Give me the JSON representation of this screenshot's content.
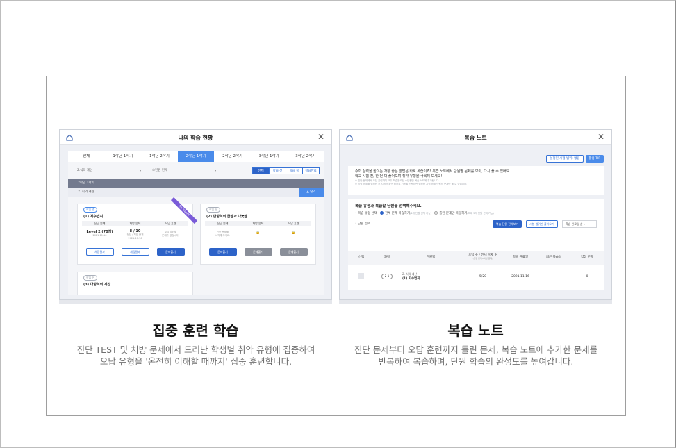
{
  "left_panel": {
    "title": "나의 학습 현황",
    "semester_tabs": [
      "전체",
      "1학년 1학기",
      "1학년 2학기",
      "2학년 1학기",
      "2학년 2학기",
      "3학년 1학기",
      "3학년 2학기"
    ],
    "active_tab": "2학년 1학기",
    "unit_select": "2.식의 계산",
    "subunit_select": "소단원 전체",
    "filter_buttons": [
      "전체",
      "학습 전",
      "학습 중",
      "학습완료"
    ],
    "semester_bar": "2학년 1학기",
    "unit_bar": "2. 식의 계산",
    "fold_button": "▲ 닫기",
    "columns": [
      "진단 문제",
      "처방 문제",
      "오답 훈련"
    ],
    "cards": [
      {
        "status": "학습 중",
        "title": "(1) 지수법칙",
        "ribbon": "최신 학습내역",
        "level": "Level 2 (70점)",
        "level_date": "2021.11.16",
        "score": "8 / 10",
        "score_sub": "정답 / 처방 문제",
        "score_date": "2021.11.16",
        "train_note_1": "오답 훈련할",
        "train_note_2": "문제가 없습니다.",
        "btn_result_1": "채점결과",
        "btn_result_2": "채점결과",
        "btn_solve": "문제풀기"
      },
      {
        "status": "학습 전",
        "title": "(2) 단항식의 곱셈과 나눗셈",
        "diag_note_1": "진단 문제를",
        "diag_note_2": "시작해 주세요.",
        "btn_solve": "문제풀기",
        "lock_1": "🔒",
        "lock_2": "🔒",
        "btn_locked_1": "문제풀기",
        "btn_locked_2": "문제풀기"
      },
      {
        "status": "학습 전",
        "title": "(3) 다항식의 계산"
      }
    ]
  },
  "right_panel": {
    "title": "복습 노트",
    "btn_scope": "설정된 시험 범위: 없음",
    "btn_tip": "활용 TIP",
    "intro_1": "수학 실력을 높이는 가장 좋은 방법은 바로 복습이죠! 복습 노트에서 단원별 문제를 모아, 다시 풀 수 있어요.",
    "intro_2": "학교 시험 전, 한 번 더 풀어보며 취약 유형을 극복해 보세요!",
    "intro_note_1": "※ 진단 문제에서 오답 훈련까지 모두 학습완료된 소단원만 복습 노트에 추가됩니다.",
    "intro_note_2": "※ 시험 범위를 설정한 후 시험 범위만 풀어요 기능을 선택하면 설정한 시험 범위 단원의 문제만 볼 수 있습니다.",
    "review_question": "복습 유형과 복습할 단원을 선택해주세요.",
    "radio_label": "복습 유형 선택",
    "radio_1": "전체 문제 복습하기",
    "radio_1_note": "(1개 단원 선택 가능)",
    "radio_2": "틀린 문제만 복습하기",
    "radio_2_note": "(최대 5개 단원 선택 가능)",
    "unit_choice_label": "단원 선택",
    "btn_view_all": "복습 단원 전체보기",
    "btn_exam_range": "시험 범위만 풀어요기",
    "sort_select": "학습 완료일 순",
    "table_headers": [
      "선택",
      "과정",
      "단원명",
      "오답 수 / 전체 문제 수",
      "학습 완료일",
      "최근 복습일",
      "약점 문제"
    ],
    "table_header_sub": "(진단 문제+처방 문제)",
    "rows": [
      {
        "course": "2-1",
        "unit_main": "2. 식의 계산",
        "unit_sub": "(1) 지수법칙",
        "ratio": "5/20",
        "completed": "2021.11.16",
        "last_review": "",
        "weak": "0"
      }
    ]
  },
  "captions": {
    "left_title": "집중 훈련 학습",
    "left_desc_1": "진단 TEST 및 처방 문제에서 드러난 학생별 취약 유형에 집중하여",
    "left_desc_2": "오답 유형을 '온전히 이해할 때까지' 집중 훈련합니다.",
    "right_title": "복습 노트",
    "right_desc_1": "진단 문제부터 오답 훈련까지 틀린 문제, 복습 노트에 추가한 문제를",
    "right_desc_2": "반복하여 복습하며, 단원 학습의 완성도를 높여갑니다."
  },
  "colors": {
    "accent": "#4a8bea",
    "accent_dark": "#2d63c8",
    "ribbon": "#7a5bd8",
    "semester_bar": "#737a8e"
  }
}
